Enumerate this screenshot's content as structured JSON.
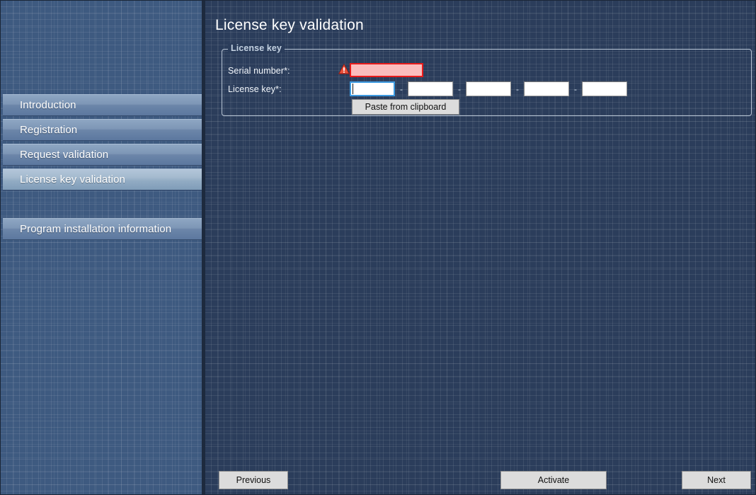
{
  "page": {
    "title": "License key validation"
  },
  "sidebar": {
    "items": [
      {
        "label": "Introduction",
        "active": false
      },
      {
        "label": "Registration",
        "active": false
      },
      {
        "label": "Request validation",
        "active": false
      },
      {
        "label": "License key validation",
        "active": true
      },
      {
        "label": "Program installation information",
        "active": false
      }
    ]
  },
  "groupbox": {
    "title": "License key",
    "serial": {
      "label": "Serial number*:",
      "value": "",
      "placeholder": "",
      "error": true,
      "warning_icon": "warning-triangle-icon"
    },
    "license_key": {
      "label": "License key*:",
      "separator": "-",
      "segments": [
        {
          "value": "",
          "focused": true
        },
        {
          "value": "",
          "focused": false
        },
        {
          "value": "",
          "focused": false
        },
        {
          "value": "",
          "focused": false
        },
        {
          "value": "",
          "focused": false
        }
      ]
    },
    "paste_button": "Paste from clipboard"
  },
  "footer": {
    "previous": "Previous",
    "activate": "Activate",
    "next": "Next"
  },
  "colors": {
    "background": "#2b3d5b",
    "sidebar": "#3e5a80",
    "nav_item": "#7d96b6",
    "nav_item_active": "#a4bace",
    "error_border": "#e81b1b",
    "error_fill": "#fbbdbd",
    "focus_border": "#3c9ae0",
    "button_face": "#dcdcdc",
    "text": "#ffffff"
  }
}
